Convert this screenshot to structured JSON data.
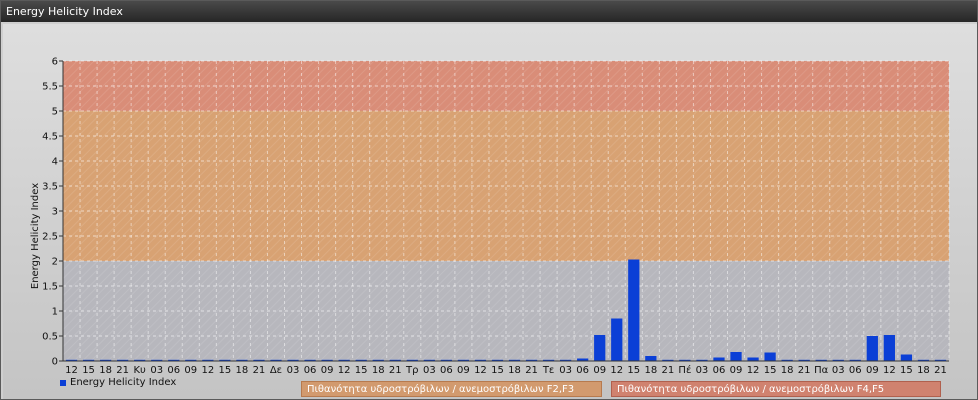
{
  "window": {
    "title": "Energy Helicity Index"
  },
  "legend": {
    "label": "Energy Helicity Index"
  },
  "bands": [
    {
      "label": "Πιθανότητα υδροστρόβιλων / ανεμοστρόβιλων F2,F3",
      "from": 2,
      "to": 5,
      "color": "#d9a06f"
    },
    {
      "label": "Πιθανότητα υδροστρόβιλων / ανεμοστρόβιλων F4,F5",
      "from": 5,
      "to": 6,
      "color": "#da8a74"
    }
  ],
  "chart_data": {
    "type": "bar",
    "title": "",
    "xlabel": "",
    "ylabel": "Energy Helicity Index",
    "ylim": [
      0,
      6
    ],
    "yticks": [
      "0",
      "0.5",
      "1",
      "1.5",
      "2",
      "2.5",
      "3",
      "3.5",
      "4",
      "4.5",
      "5",
      "5.5",
      "6"
    ],
    "grid": true,
    "legend_position": "bottom-left",
    "bar_color": "#0b3fd6",
    "categories": [
      "12",
      "15",
      "18",
      "21",
      "Κυ",
      "03",
      "06",
      "09",
      "12",
      "15",
      "18",
      "21",
      "Δε",
      "03",
      "06",
      "09",
      "12",
      "15",
      "18",
      "21",
      "Τρ",
      "03",
      "06",
      "09",
      "12",
      "15",
      "18",
      "21",
      "Τε",
      "03",
      "06",
      "09",
      "12",
      "15",
      "18",
      "21",
      "Πέ",
      "03",
      "06",
      "09",
      "12",
      "15",
      "18",
      "21",
      "Πα",
      "03",
      "06",
      "09",
      "12",
      "15",
      "18",
      "21"
    ],
    "series": [
      {
        "name": "Energy Helicity Index",
        "values": [
          0,
          0,
          0,
          0,
          0,
          0,
          0,
          0,
          0,
          0,
          0,
          0,
          0,
          0,
          0,
          0,
          0,
          0,
          0,
          0,
          0,
          0,
          0,
          0,
          0,
          0,
          0,
          0,
          0,
          0,
          0.05,
          0.52,
          0.85,
          2.03,
          0.1,
          0,
          0,
          0,
          0.07,
          0.18,
          0.07,
          0.17,
          0,
          0,
          0,
          0,
          0.02,
          0.5,
          0.52,
          0.13,
          0,
          0
        ]
      }
    ]
  }
}
